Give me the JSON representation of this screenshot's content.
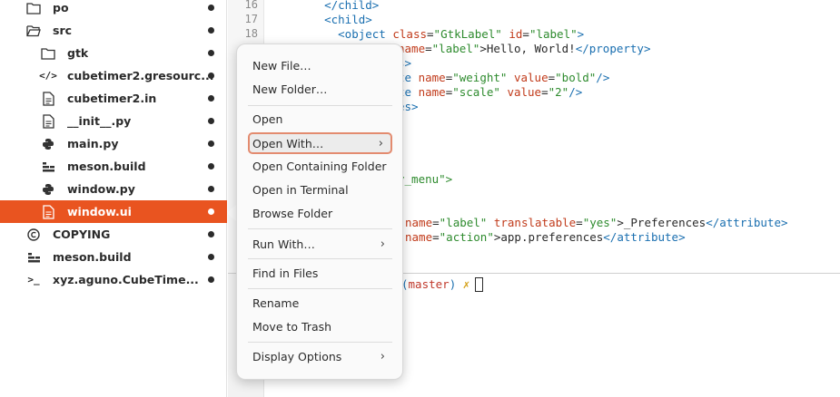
{
  "sidebar": {
    "items": [
      {
        "label": "po",
        "icon": "folder-icon"
      },
      {
        "label": "src",
        "icon": "folder-open-icon"
      },
      {
        "label": "gtk",
        "icon": "folder-icon"
      },
      {
        "label": "cubetimer2.gresourc...",
        "icon": "code-icon"
      },
      {
        "label": "cubetimer2.in",
        "icon": "text-file-icon"
      },
      {
        "label": "__init__.py",
        "icon": "text-file-icon"
      },
      {
        "label": "main.py",
        "icon": "python-icon"
      },
      {
        "label": "meson.build",
        "icon": "build-icon"
      },
      {
        "label": "window.py",
        "icon": "python-icon"
      },
      {
        "label": "window.ui",
        "icon": "text-file-icon"
      },
      {
        "label": "COPYING",
        "icon": "copyright-icon"
      },
      {
        "label": "meson.build",
        "icon": "build-icon"
      },
      {
        "label": "xyz.aguno.CubeTime...",
        "icon": "terminal-icon"
      }
    ]
  },
  "editor": {
    "line_numbers": [
      "16",
      "17",
      "18"
    ],
    "lines": [
      {
        "p": [
          "    ",
          "</child>"
        ]
      },
      {
        "p": [
          "    ",
          "<child>"
        ]
      },
      {
        "p": [
          "      ",
          "<object ",
          "class",
          "=",
          "\"GtkLabel\"",
          " ",
          "id",
          "=",
          "\"label\"",
          ">"
        ]
      },
      {
        "p": [
          "name",
          "=",
          "\"label\"",
          ">Hello, World!",
          "</property>"
        ]
      },
      {
        "p": [
          "s>"
        ]
      },
      {
        "p": [
          "te ",
          "name",
          "=",
          "\"weight\"",
          " ",
          "value",
          "=",
          "\"bold\"",
          "/>"
        ]
      },
      {
        "p": [
          "te ",
          "name",
          "=",
          "\"scale\"",
          " ",
          "value",
          "=",
          "\"2\"",
          "/>"
        ]
      },
      {
        "p": [
          "es>"
        ]
      },
      {
        "p": [
          "y_menu\">"
        ]
      },
      {
        "p": [
          "name",
          "=",
          "\"label\"",
          " ",
          "translatable",
          "=",
          "\"yes\"",
          ">_Preferences",
          "</attribute>"
        ]
      },
      {
        "p": [
          "name",
          "=",
          "\"action\"",
          ">app.preferences",
          "</attribute>"
        ]
      }
    ]
  },
  "terminal": {
    "branch_open": "(",
    "branch": "master",
    "branch_close": ")",
    "mark": "✗"
  },
  "context_menu": {
    "items": [
      {
        "label": "New File…"
      },
      {
        "label": "New Folder…"
      },
      {
        "label": "Open"
      },
      {
        "label": "Open With…",
        "chevron": "›"
      },
      {
        "label": "Open Containing Folder"
      },
      {
        "label": "Open in Terminal"
      },
      {
        "label": "Browse Folder"
      },
      {
        "label": "Run With…",
        "chevron": "›"
      },
      {
        "label": "Find in Files"
      },
      {
        "label": "Rename"
      },
      {
        "label": "Move to Trash"
      },
      {
        "label": "Display Options",
        "chevron": "›"
      }
    ]
  },
  "colors": {
    "selection": "#e95420",
    "hover_border": "#e38b6f",
    "xml_tag": "#1a6fb0",
    "xml_attr": "#c13b1b",
    "xml_string": "#2e8b2e"
  }
}
